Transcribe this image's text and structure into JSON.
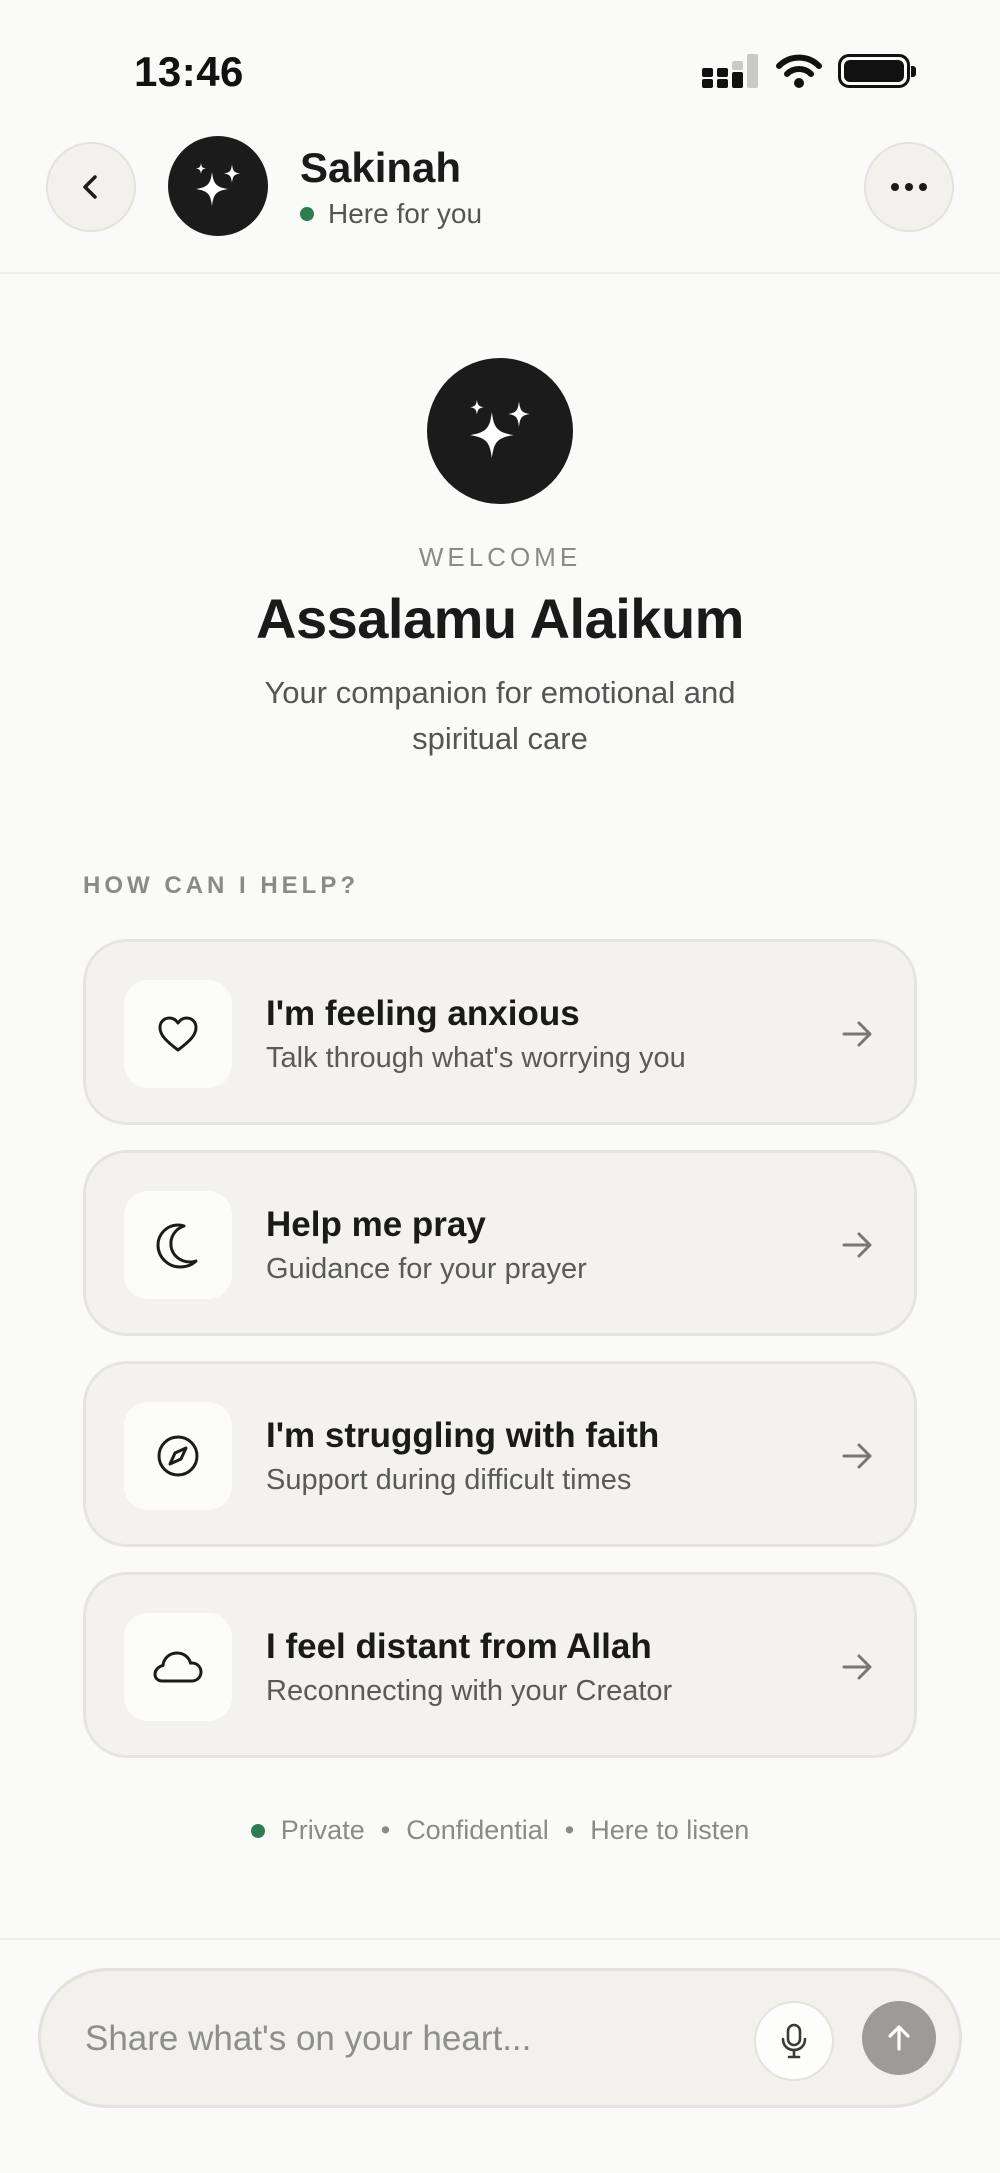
{
  "status_bar": {
    "time": "13:46"
  },
  "header": {
    "name": "Sakinah",
    "status": "Here for you"
  },
  "welcome": {
    "eyebrow": "WELCOME",
    "title": "Assalamu Alaikum",
    "subtitle": "Your companion for emotional and spiritual care"
  },
  "help": {
    "label": "HOW CAN I HELP?",
    "cards": [
      {
        "title": "I'm feeling anxious",
        "subtitle": "Talk through what's worrying you",
        "icon": "heart-icon"
      },
      {
        "title": "Help me pray",
        "subtitle": "Guidance for your prayer",
        "icon": "moon-icon"
      },
      {
        "title": "I'm struggling with faith",
        "subtitle": "Support during difficult times",
        "icon": "compass-icon"
      },
      {
        "title": "I feel distant from Allah",
        "subtitle": "Reconnecting with your Creator",
        "icon": "cloud-icon"
      }
    ]
  },
  "footer": {
    "note_1": "Private",
    "separator": "•",
    "note_2": "Confidential",
    "note_3": "Here to listen"
  },
  "composer": {
    "placeholder": "Share what's on your heart...",
    "value": ""
  },
  "colors": {
    "background": "#FAFAF8",
    "card": "#F3F2EE",
    "accent_dark": "#1B1B1B",
    "online_green": "#2E7D50",
    "send_disabled": "#9C9B98"
  }
}
